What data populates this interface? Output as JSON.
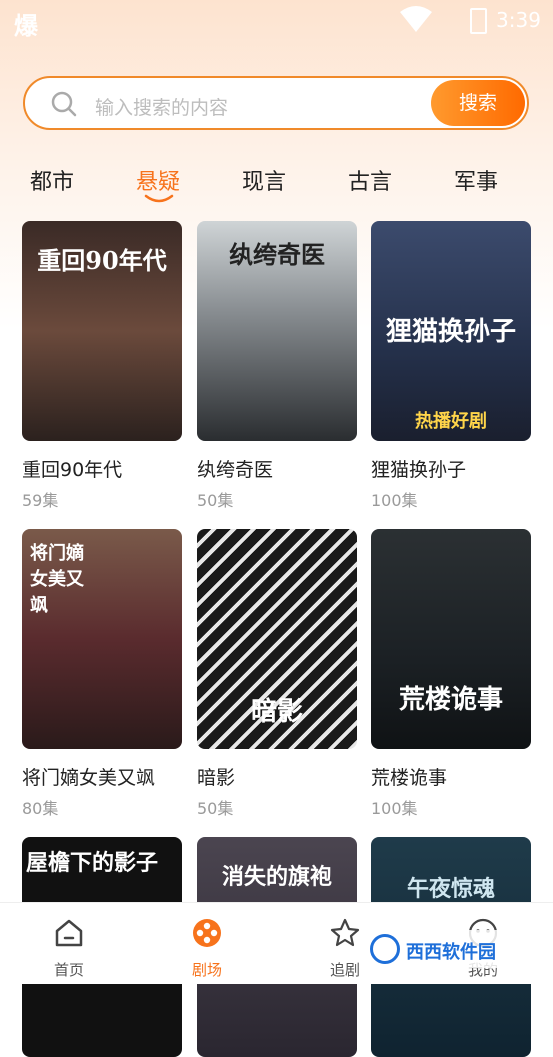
{
  "statusbar": {
    "app_glyph": "爆",
    "time": "3:39"
  },
  "search": {
    "placeholder": "输入搜索的内容",
    "button": "搜索"
  },
  "tabs": [
    {
      "label": "都市",
      "active": false
    },
    {
      "label": "悬疑",
      "active": true
    },
    {
      "label": "现言",
      "active": false
    },
    {
      "label": "古言",
      "active": false
    },
    {
      "label": "军事",
      "active": false
    }
  ],
  "dramas": [
    {
      "title": "重回90年代",
      "episodes": "59集",
      "poster_text": "重回90年代"
    },
    {
      "title": "纨绔奇医",
      "episodes": "50集",
      "poster_text": "纨绔奇医"
    },
    {
      "title": "狸猫换孙子",
      "episodes": "100集",
      "poster_text": "狸猫换孙子",
      "poster_sub": "热播好剧"
    },
    {
      "title": "将门嫡女美又飒",
      "episodes": "80集",
      "poster_text": "将门嫡女美又飒"
    },
    {
      "title": "暗影",
      "episodes": "50集",
      "poster_text": "暗影"
    },
    {
      "title": "荒楼诡事",
      "episodes": "100集",
      "poster_text": "荒楼诡事"
    },
    {
      "poster_text": "屋檐下的影子"
    },
    {
      "poster_text": "消失的旗袍"
    },
    {
      "poster_text": "午夜惊魂"
    }
  ],
  "nav": [
    {
      "label": "首页",
      "icon": "home-icon",
      "active": false
    },
    {
      "label": "剧场",
      "icon": "film-reel-icon",
      "active": true
    },
    {
      "label": "追剧",
      "icon": "star-icon",
      "active": false
    },
    {
      "label": "我的",
      "icon": "user-icon",
      "active": false
    }
  ],
  "watermark": {
    "text": "西西软件园"
  },
  "colors": {
    "accent": "#f7731c",
    "search_border": "#f08a2a"
  }
}
